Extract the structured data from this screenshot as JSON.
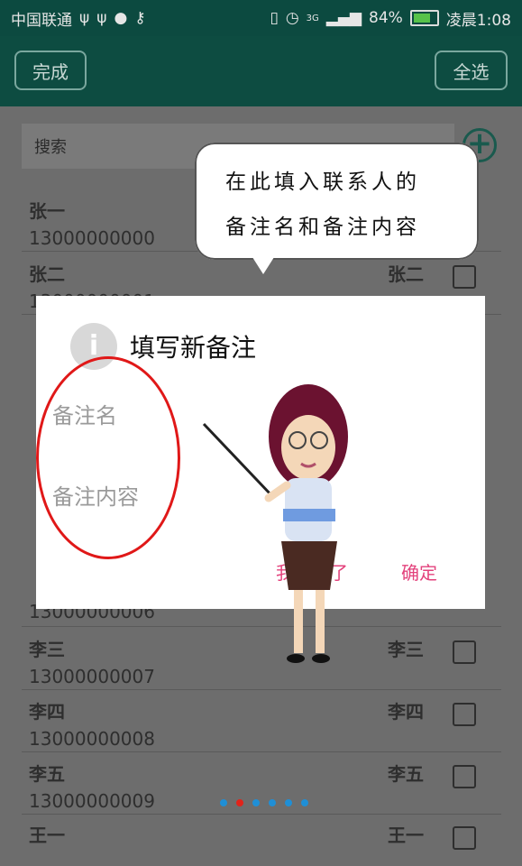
{
  "status": {
    "carrier": "中国联通",
    "left_icons": [
      "usb-icon",
      "usb-icon",
      "chat-icon",
      "wrench-icon"
    ],
    "battery": "84%",
    "time": "凌晨1:08",
    "signal": "3G"
  },
  "toolbar": {
    "done_label": "完成",
    "select_all_label": "全选"
  },
  "search": {
    "placeholder": "搜索"
  },
  "contacts": [
    {
      "name": "张一",
      "phone": "13000000000",
      "alias": ""
    },
    {
      "name": "张二",
      "phone": "13000000001",
      "alias": "张二"
    },
    {
      "name": "李三",
      "phone": "13000000007",
      "alias": "李三"
    },
    {
      "name": "李四",
      "phone": "13000000008",
      "alias": "李四"
    },
    {
      "name": "李五",
      "phone": "13000000009",
      "alias": "李五"
    },
    {
      "name": "王一",
      "phone": "",
      "alias": "王一"
    }
  ],
  "partial_phone": "13000000006",
  "bubble": {
    "line1": "在此填入联系人的",
    "line2": "备注名和备注内容"
  },
  "dialog": {
    "title": "填写新备注",
    "field_name": "备注名",
    "field_content": "备注内容",
    "cancel_label": "我不写了",
    "confirm_label": "确定"
  },
  "colors": {
    "appbar": "#0d4c41",
    "accent": "#e3427c",
    "highlight_oval": "#e01818"
  }
}
